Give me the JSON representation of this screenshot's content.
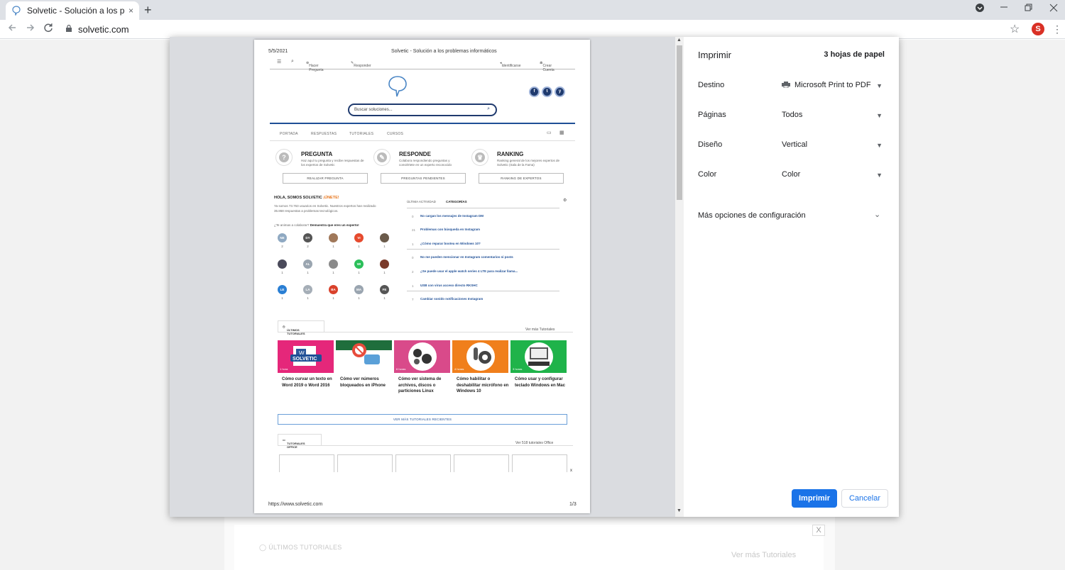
{
  "browser": {
    "tab_title": "Solvetic - Solución a los problemas informáticos",
    "tab_close": "×",
    "new_tab": "+",
    "url": "solvetic.com",
    "avatar_letter": "S",
    "accent": "#1a73e8"
  },
  "preview": {
    "header_date": "5/5/2021",
    "header_title": "Solvetic - Solución a los problemas informáticos",
    "footer_url": "https://www.solvetic.com",
    "footer_page": "1/3",
    "site": {
      "nav": {
        "ask": "Hacer Pregunta",
        "answer": "Responder",
        "login": "Identificarse",
        "register": "Crear Cuenta"
      },
      "social": [
        "f",
        "t",
        "y"
      ],
      "search_placeholder": "Buscar soluciones...",
      "menu": [
        "PORTADA",
        "RESPUESTAS",
        "TUTORIALES",
        "CURSOS"
      ],
      "cards": [
        {
          "title": "PREGUNTA",
          "desc": "Haz aquí tu pregunta y recibe respuestas de los expertos de Solvetic",
          "button": "REALIZAR PREGUNTA"
        },
        {
          "title": "RESPONDE",
          "desc": "Colabora respondiendo preguntas y conviértete en un experto reconocido",
          "button": "PREGUNTAS PENDIENTES"
        },
        {
          "title": "RANKING",
          "desc": "Ranking general de los mejores expertos de Solvetic (Sala de la Fama)",
          "button": "RANKING DE EXPERTOS"
        }
      ],
      "hola_title": "HOLA, SOMOS SOLVETIC",
      "hola_join": "¡ÚNETE!",
      "hola_text": "Ya somos 73.763 usuarios en Solvetic. Nuestros expertos han realizado 35.868 respuestas a problemas tecnológicos.",
      "hola_cta": "¿Te animas a colaborar?",
      "hola_cta_bold": "Demuestra que eres un experto!",
      "experts": [
        {
          "label": "NE",
          "count": "2",
          "color": "#8fa9c2"
        },
        {
          "label": "DY",
          "count": "2",
          "color": "#555555"
        },
        {
          "label": "",
          "count": "1",
          "color": "#a0785a"
        },
        {
          "label": "VI",
          "count": "1",
          "color": "#e64a2e"
        },
        {
          "label": "",
          "count": "1",
          "color": "#6a5a4a"
        },
        {
          "label": "",
          "count": "1",
          "color": "#4a4a5a"
        },
        {
          "label": "AL",
          "count": "1",
          "color": "#9aa5b0"
        },
        {
          "label": "",
          "count": "1",
          "color": "#8a8a8a"
        },
        {
          "label": "WI",
          "count": "1",
          "color": "#2bbf5a"
        },
        {
          "label": "",
          "count": "1",
          "color": "#7a3a2a"
        },
        {
          "label": "LE",
          "count": "1",
          "color": "#2a7fd4"
        },
        {
          "label": "LA",
          "count": "1",
          "color": "#a5aeb7"
        },
        {
          "label": "BA",
          "count": "1",
          "color": "#d9412b"
        },
        {
          "label": "MA",
          "count": "1",
          "color": "#9aa5b0"
        },
        {
          "label": "FE",
          "count": "1",
          "color": "#555555"
        }
      ],
      "activity_tab1": "ÚLTIMA ACTIVIDAD",
      "activity_tab2": "CATEGORÍAS",
      "activity": [
        {
          "num": "0",
          "text": "No cargan los mensajes de Instagram DM"
        },
        {
          "num": "21",
          "text": "Problemas con búsqueda en Instagram"
        },
        {
          "num": "1",
          "text": "¿Cómo reparar bootea en Windows 10?"
        },
        {
          "num": "0",
          "text": "No me pueden mencionar en Instagram comentarios ni posts"
        },
        {
          "num": "2",
          "text": "¿Se puede usar el apple watch series 4 LTE para realizar llama..."
        },
        {
          "num": "1",
          "text": "USB con virus acceso directo RKSHC"
        },
        {
          "num": "7",
          "text": "Cambiar sonido notificaciones Instagram"
        }
      ],
      "tutorials_tab": "ÚLTIMOS TUTORIALES",
      "tutorials_more": "Ver más Tutoriales",
      "tutorials": [
        {
          "title": "Cómo curvar un texto en Word 2019 o Word 2016",
          "time": "1 hora",
          "color": "#e5277a",
          "logo_text": "SOLVETIC"
        },
        {
          "title": "Cómo ver números bloqueados en iPhone",
          "time": "2 horas",
          "color": "#1f6e3c"
        },
        {
          "title": "Cómo ver sistema de archivos, discos o particiones Linux",
          "time": "6 horas",
          "color": "#d94a8a"
        },
        {
          "title": "Cómo habilitar o deshabilitar micrófono en Windows 10",
          "time": "4 horas",
          "color": "#f07f1c"
        },
        {
          "title": "Cómo usar y configurar teclado Windows en Mac",
          "time": "3 horas",
          "color": "#1fb34a"
        }
      ],
      "more_recent": "VER MÁS TUTORIALES RECIENTES",
      "office_tab": "TUTORIALES OFFICE",
      "office_more": "Ver 518 tutoriales Office",
      "close_x": "x"
    }
  },
  "settings": {
    "title": "Imprimir",
    "sheets": "3 hojas de papel",
    "fields": [
      {
        "label": "Destino",
        "value": "Microsoft Print to PDF"
      },
      {
        "label": "Páginas",
        "value": "Todos"
      },
      {
        "label": "Diseño",
        "value": "Vertical"
      },
      {
        "label": "Color",
        "value": "Color"
      }
    ],
    "more_options": "Más opciones de configuración",
    "print_button": "Imprimir",
    "cancel_button": "Cancelar"
  },
  "background_page": {
    "close": "X",
    "tutorials_label": "ÚLTIMOS TUTORIALES",
    "more_tutorials": "Ver más Tutoriales"
  }
}
